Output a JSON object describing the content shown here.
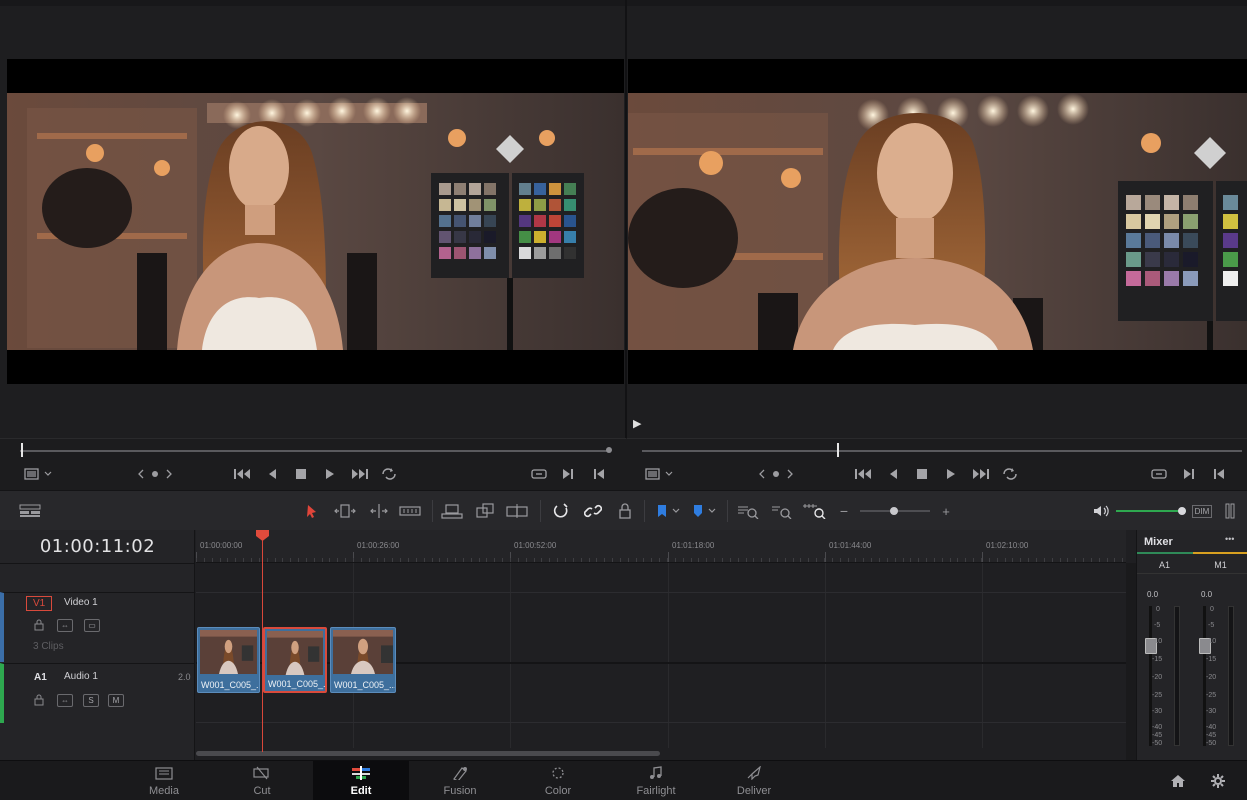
{
  "viewer": {
    "source_frame_indicator": "▶"
  },
  "toolbar": {
    "dim_label": "DIM"
  },
  "timeline": {
    "timecode": "01:00:11:02",
    "ruler_labels": [
      "01:00:00:00",
      "01:00:26:00",
      "01:00:52:00",
      "01:01:18:00",
      "01:01:44:00",
      "01:02:10:00"
    ],
    "video_track": {
      "badge": "V1",
      "name": "Video 1",
      "clip_count": "3 Clips"
    },
    "audio_track": {
      "badge": "A1",
      "name": "Audio 1",
      "channels": "2.0",
      "solo": "S",
      "mute": "M"
    },
    "clips": [
      {
        "name": "W001_C005_...",
        "selected": false
      },
      {
        "name": "W001_C005_...",
        "selected": true
      },
      {
        "name": "W001_C005_...",
        "selected": false
      }
    ]
  },
  "mixer": {
    "title": "Mixer",
    "more": "•••",
    "channels": [
      {
        "label": "A1",
        "level": "0.0"
      },
      {
        "label": "M1",
        "level": "0.0"
      }
    ],
    "scale": [
      "0",
      "-5",
      "-10",
      "-15",
      "-20",
      "-25",
      "-30",
      "-40",
      "-45",
      "-50"
    ]
  },
  "pages": [
    {
      "label": "Media",
      "icon": "media-icon"
    },
    {
      "label": "Cut",
      "icon": "cut-icon"
    },
    {
      "label": "Edit",
      "icon": "edit-icon",
      "active": true
    },
    {
      "label": "Fusion",
      "icon": "fusion-icon"
    },
    {
      "label": "Color",
      "icon": "color-icon"
    },
    {
      "label": "Fairlight",
      "icon": "fairlight-icon"
    },
    {
      "label": "Deliver",
      "icon": "deliver-icon"
    }
  ],
  "colors": {
    "accent_green": "#2f8a58",
    "clip_blue": "#3e6f9d",
    "playhead_red": "#e04b3c",
    "audio_green": "#2ea84f"
  }
}
